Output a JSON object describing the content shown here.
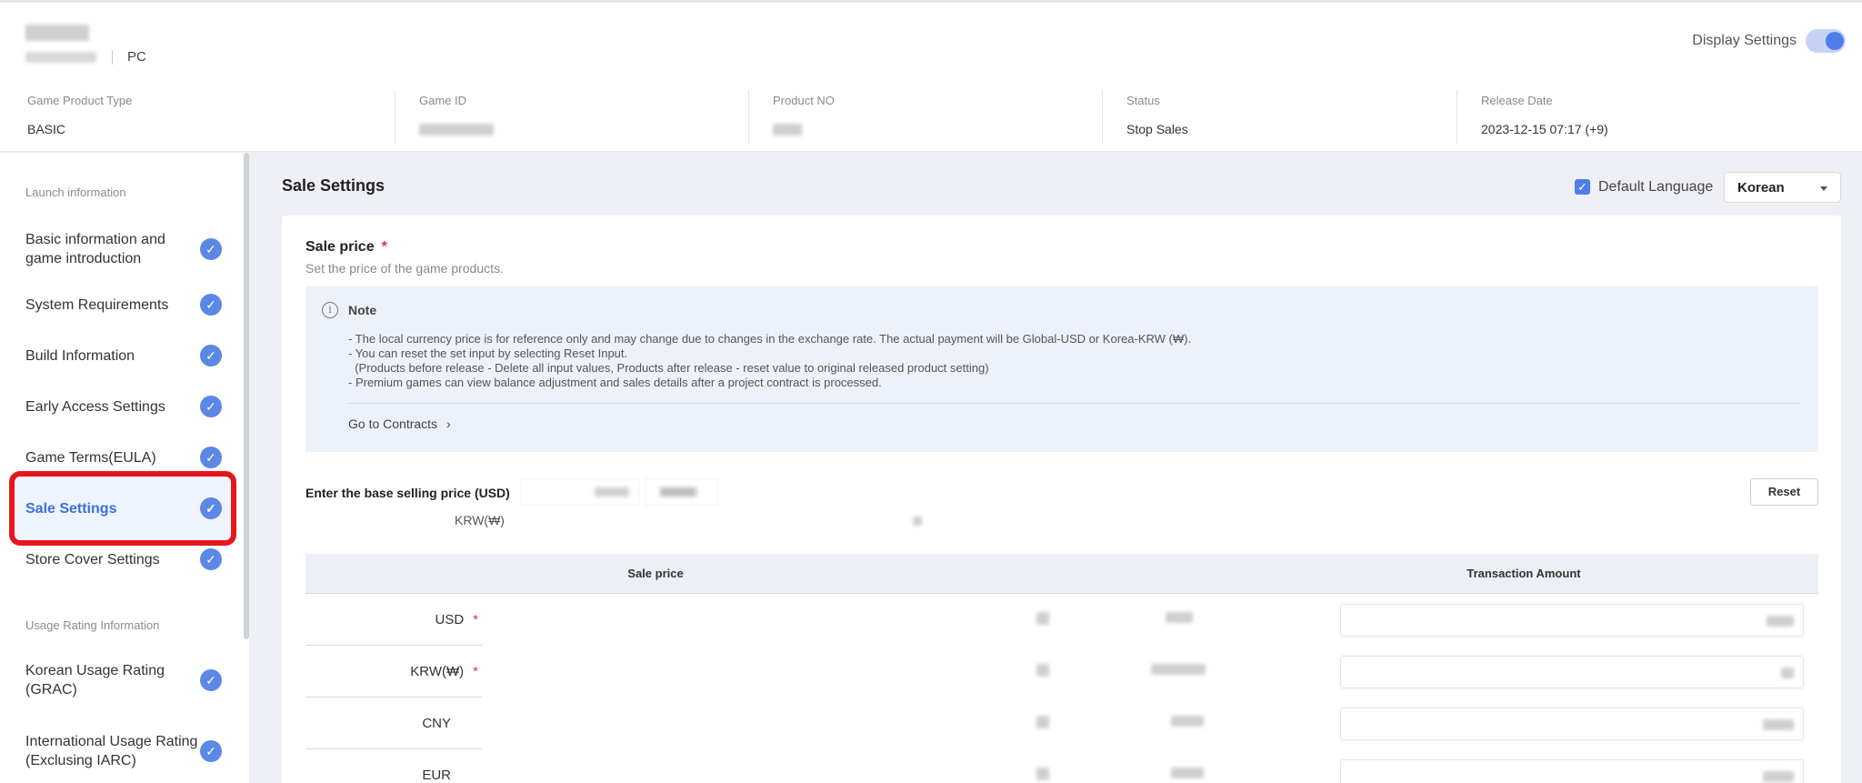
{
  "header": {
    "platform": "PC",
    "display_settings_label": "Display Settings",
    "info": [
      {
        "label": "Game Product Type",
        "value": "BASIC"
      },
      {
        "label": "Game ID",
        "value": ""
      },
      {
        "label": "Product NO",
        "value": ""
      },
      {
        "label": "Status",
        "value": "Stop Sales"
      },
      {
        "label": "Release Date",
        "value": "2023-12-15 07:17 (+9)"
      }
    ]
  },
  "sidebar": {
    "section_launch": "Launch information",
    "section_usage": "Usage Rating Information",
    "items": [
      {
        "label": "Basic information and game introduction",
        "active": false
      },
      {
        "label": "System Requirements",
        "active": false
      },
      {
        "label": "Build Information",
        "active": false
      },
      {
        "label": "Early Access Settings",
        "active": false
      },
      {
        "label": "Game Terms(EULA)",
        "active": false
      },
      {
        "label": "Sale Settings",
        "active": true
      },
      {
        "label": "Store Cover Settings",
        "active": false
      },
      {
        "label": "Korean Usage Rating (GRAC)",
        "active": false
      },
      {
        "label": "International Usage Rating (Exclusing IARC)",
        "active": false
      }
    ]
  },
  "main": {
    "page_title": "Sale Settings",
    "default_language_label": "Default Language",
    "language_selected": "Korean",
    "sale_price_title": "Sale price",
    "required_mark": "*",
    "sale_price_desc": "Set the price of the game products.",
    "note": {
      "title": "Note",
      "info_icon": "i",
      "lines": [
        "- The local currency price is for reference only and may change due to changes in the exchange rate. The actual payment will be Global-USD or Korea-KRW (₩).",
        "- You can reset the set input by selecting Reset Input.",
        "  (Products before release - Delete all input values, Products after release - reset value to original released product setting)",
        "- Premium games can view balance adjustment and sales details after a project contract is processed."
      ],
      "link": "Go to Contracts",
      "link_chevron": "›"
    },
    "base_price_label": "Enter the base selling price (USD)",
    "krw_label": "KRW(₩)",
    "reset_label": "Reset",
    "table": {
      "headers": [
        "Sale price",
        "Transaction Amount"
      ],
      "rows": [
        {
          "currency": "USD",
          "required": true
        },
        {
          "currency": "KRW(₩)",
          "required": true
        },
        {
          "currency": "CNY",
          "required": false
        },
        {
          "currency": "EUR",
          "required": false
        }
      ]
    }
  },
  "colors": {
    "accent": "#4f7de9",
    "highlight_border": "#e6161e",
    "required": "#e8333a"
  },
  "icons": {
    "check": "✓",
    "toggle": "toggle-icon"
  }
}
